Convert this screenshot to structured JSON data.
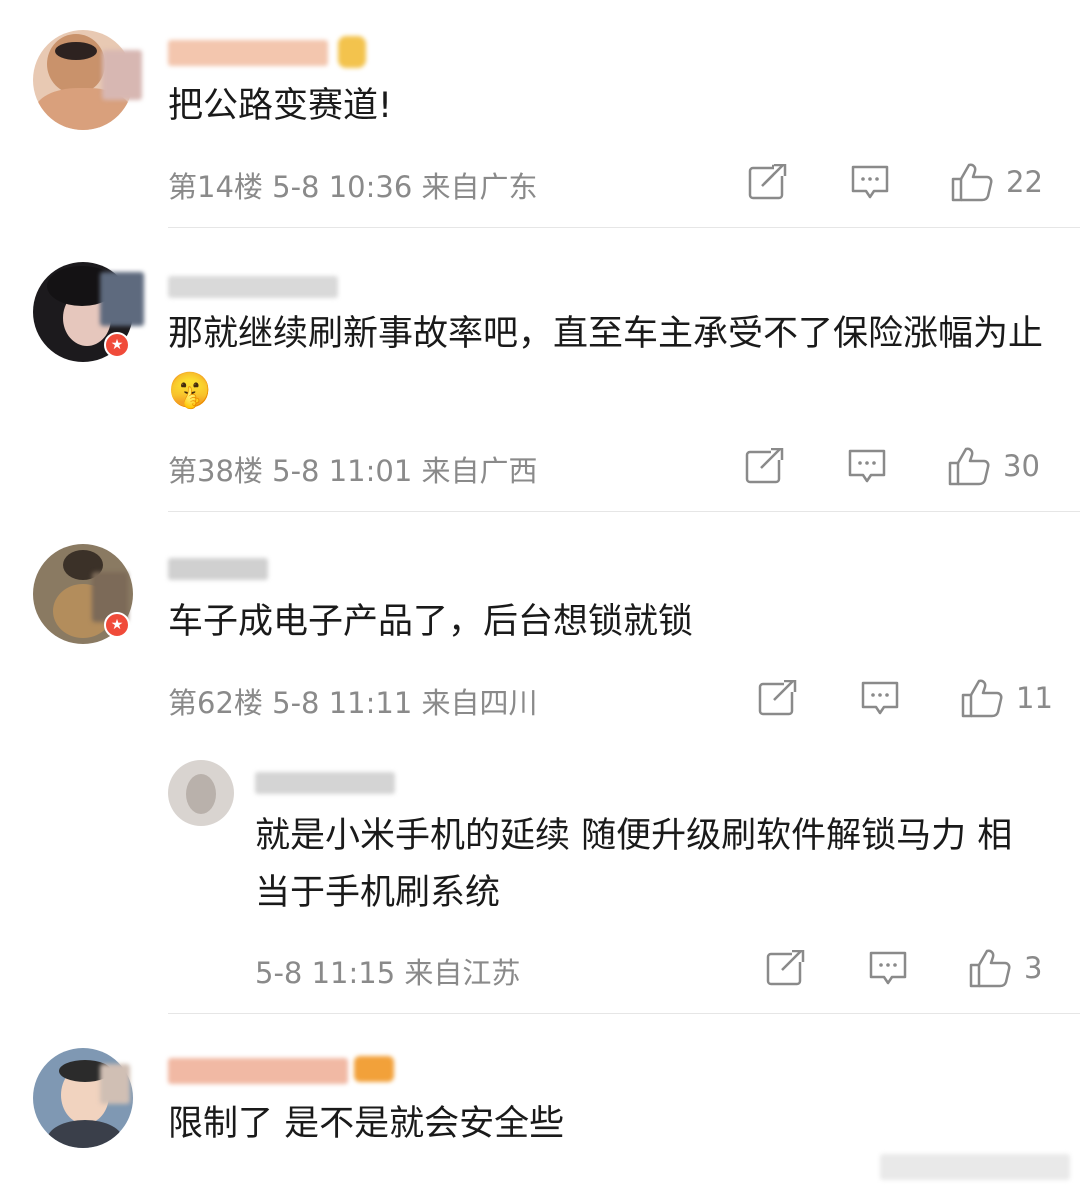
{
  "comments": [
    {
      "text": "把公路变赛道!",
      "floor_time_location": "第14楼 5-8 10:36 来自广东",
      "likes": "22"
    },
    {
      "text": "那就继续刷新事故率吧，直至车主承受不了保险涨幅为止",
      "emoji": "🤫",
      "floor_time_location": "第38楼 5-8 11:01 来自广西",
      "likes": "30"
    },
    {
      "text": "车子成电子产品了，后台想锁就锁",
      "floor_time_location": "第62楼 5-8 11:11 来自四川",
      "likes": "11"
    },
    {
      "text": "就是小米手机的延续 随便升级刷软件解锁马力 相当于手机刷系统",
      "floor_time_location": "5-8 11:15 来自江苏",
      "likes": "3"
    },
    {
      "text": "限制了 是不是就会安全些"
    }
  ],
  "icons": {
    "repost": "share-icon",
    "comment": "comment-icon",
    "like": "thumbs-up-icon",
    "verified": "star-badge-icon"
  },
  "colors": {
    "meta_gray": "#8a8a8a",
    "badge_red": "#f04b3a",
    "divider": "#e6e6e6"
  }
}
